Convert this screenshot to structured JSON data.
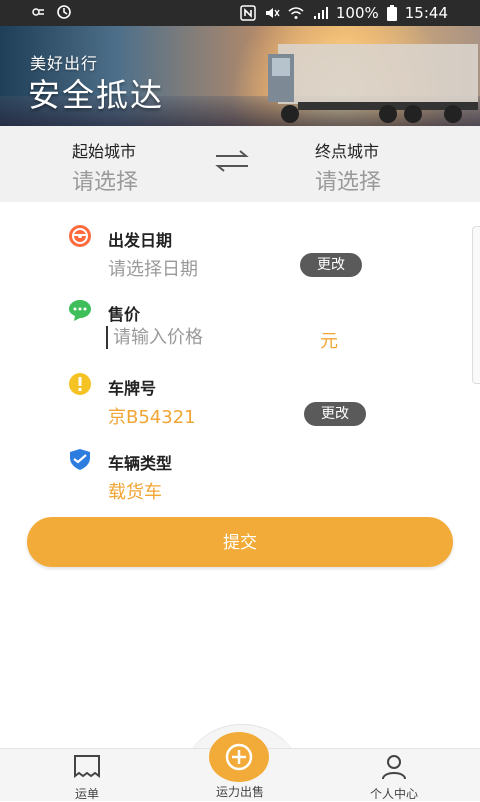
{
  "status_bar": {
    "battery": "100%",
    "time": "15:44",
    "icons_left": [
      "weather-icon",
      "sync-icon"
    ],
    "icons_right": [
      "nfc-icon",
      "mute-icon",
      "wifi-icon",
      "signal-icon",
      "battery-icon"
    ]
  },
  "banner": {
    "line1": "美好出行",
    "line2": "安全抵达"
  },
  "city": {
    "from_label": "起始城市",
    "from_value": "请选择",
    "to_label": "终点城市",
    "to_value": "请选择",
    "swap_icon": "swap-arrows-icon"
  },
  "form": {
    "date": {
      "title": "出发日期",
      "value": "请选择日期",
      "action": "更改",
      "icon": "steering-wheel-icon"
    },
    "price": {
      "title": "售价",
      "placeholder": "请输入价格",
      "unit": "元",
      "icon": "chat-bubble-icon"
    },
    "plate": {
      "title": "车牌号",
      "value": "京B54321",
      "action": "更改",
      "icon": "plate-icon"
    },
    "vehicle": {
      "title": "车辆类型",
      "value": "载货车",
      "icon": "shield-icon"
    }
  },
  "submit_label": "提交",
  "nav": {
    "items": [
      {
        "label": "运单",
        "icon": "waybill-icon"
      },
      {
        "label": "运力出售",
        "icon": "plus-circle-icon"
      },
      {
        "label": "个人中心",
        "icon": "user-icon"
      }
    ]
  },
  "colors": {
    "accent": "#f2ab38",
    "statusbar": "#2b2b2b",
    "pill": "#5a5a5a"
  }
}
